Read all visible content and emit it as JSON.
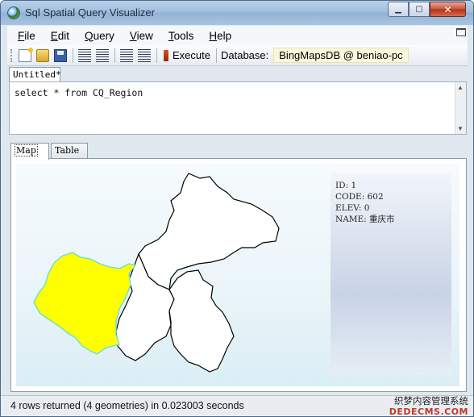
{
  "window": {
    "title": "Sql Spatial Query Visualizer",
    "controls": {
      "minimize": "▁",
      "maximize": "▢",
      "close": "✕"
    }
  },
  "menubar": {
    "items": [
      {
        "label": "File",
        "accel": "F",
        "rest": "ile"
      },
      {
        "label": "Edit",
        "accel": "E",
        "rest": "dit"
      },
      {
        "label": "Query",
        "accel": "Q",
        "rest": "uery"
      },
      {
        "label": "View",
        "accel": "V",
        "rest": "iew"
      },
      {
        "label": "Tools",
        "accel": "T",
        "rest": "ools"
      },
      {
        "label": "Help",
        "accel": "H",
        "rest": "elp"
      }
    ]
  },
  "toolbar": {
    "execute_label": "Execute",
    "database_label": "Database:",
    "database_value": "BingMapsDB @ beniao-pc",
    "icons": [
      "new-file-icon",
      "open-folder-icon",
      "save-icon",
      "decrease-indent-icon",
      "increase-indent-icon",
      "comment-icon",
      "uncomment-icon",
      "execute-icon"
    ]
  },
  "document_tab": {
    "label": "Untitled*"
  },
  "editor": {
    "query_text": "select * from CQ_Region"
  },
  "view_tabs": {
    "map_label": "Map",
    "table_label": "Table"
  },
  "map": {
    "highlight_color": "#ffff00",
    "highlight_border": "#66e0d0",
    "region_fill": "#ffffff",
    "info": {
      "id_line": "ID: 1",
      "code_line": "CODE: 602",
      "elev_line": "ELEV: 0",
      "name_line": "NAME: 重庆市"
    }
  },
  "status": {
    "text": "4 rows returned (4 geometries) in 0.023003 seconds",
    "watermark_cn": "织梦内容管理系统",
    "watermark_en": "DEDECMS.COM"
  }
}
